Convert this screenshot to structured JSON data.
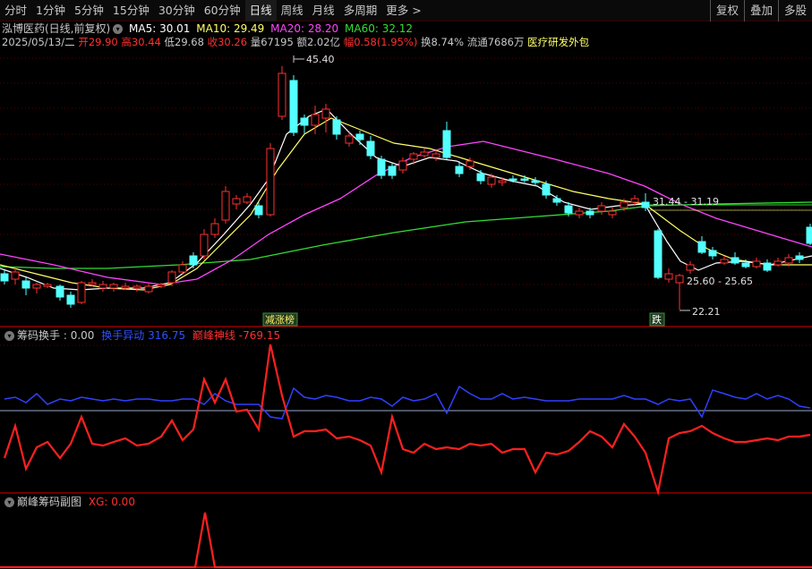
{
  "toolbar": {
    "periods": [
      "分时",
      "1分钟",
      "5分钟",
      "15分钟",
      "30分钟",
      "60分钟",
      "日线",
      "周线",
      "月线",
      "多周期"
    ],
    "active": "日线",
    "more_label": "更多",
    "more_arrow": ">",
    "right_buttons": [
      "复权",
      "叠加",
      "多股"
    ]
  },
  "stock": {
    "title": "泓博医药(日线,前复权)",
    "ma5_label": "MA5: 30.01",
    "ma10_label": "MA10: 29.49",
    "ma20_label": "MA20: 28.20",
    "ma60_label": "MA60: 32.12",
    "date": "2025/05/13/二",
    "open_label": "开",
    "open": "29.90",
    "high_label": "高",
    "high": "30.44",
    "low_label": "低",
    "low": "29.68",
    "close_label": "收",
    "close": "30.26",
    "volume_label": "量",
    "volume": "67195",
    "amount_label": "额",
    "amount": "2.02亿",
    "change_label": "幅",
    "change": "0.58(1.95%)",
    "turnover_label": "换",
    "turnover": "8.74%",
    "float_label": "流通",
    "float": "7686万",
    "sector": "医疗研发外包"
  },
  "annotations": {
    "peak": "45.40",
    "range1": "31.44 - 31.19",
    "range2": "25.60 - 25.65",
    "low": "22.21",
    "tag_reduce": "减涨榜",
    "tag_fall": "跌"
  },
  "sub1": {
    "title": "筹码换手",
    "value": ": 0.00",
    "blue_label": "换手异动",
    "blue_value": "316.75",
    "red_label": "巅峰神线",
    "red_value": "-769.15"
  },
  "sub2": {
    "title": "巅峰筹码副图",
    "xg_label": "XG:",
    "xg_value": "0.00"
  },
  "colors": {
    "up": "#ff3030",
    "down": "#54ffff",
    "ma5": "#ffffff",
    "ma10": "#ffff66",
    "ma20": "#ff44ff",
    "ma60": "#33dd33",
    "border": "#b00000"
  }
}
